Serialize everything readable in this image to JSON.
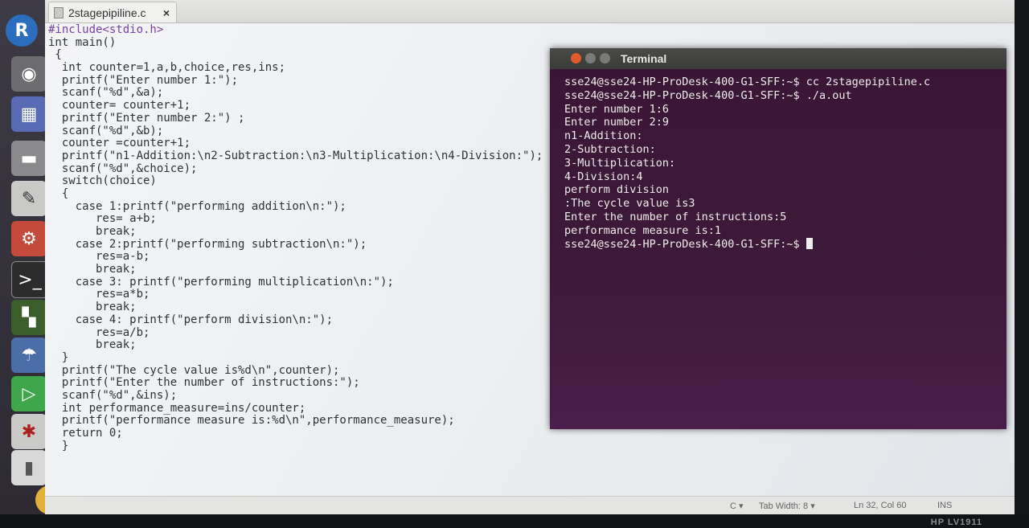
{
  "editor": {
    "tab_title": "2stagepipiline.c",
    "tab_close": "×",
    "code_lines": [
      "#include<stdio.h>",
      "int main()",
      " {",
      "  int counter=1,a,b,choice,res,ins;",
      "  printf(\"Enter number 1:\");",
      "  scanf(\"%d\",&a);",
      "  counter= counter+1;",
      "  printf(\"Enter number 2:\") ;",
      "  scanf(\"%d\",&b);",
      "  counter =counter+1;",
      "  printf(\"n1-Addition:\\n2-Subtraction:\\n3-Multiplication:\\n4-Division:\");",
      "  scanf(\"%d\",&choice);",
      "  switch(choice)",
      "  {",
      "    case 1:printf(\"performing addition\\n:\");",
      "       res= a+b;",
      "       break;",
      "    case 2:printf(\"performing subtraction\\n:\");",
      "       res=a-b;",
      "       break;",
      "    case 3: printf(\"performing multiplication\\n:\");",
      "       res=a*b;",
      "       break;",
      "    case 4: printf(\"perform division\\n:\");",
      "       res=a/b;",
      "       break;",
      "  }",
      "  printf(\"The cycle value is%d\\n\",counter);",
      "  printf(\"Enter the number of instructions:\");",
      "  scanf(\"%d\",&ins);",
      "  int performance_measure=ins/counter;",
      "  printf(\"performance measure is:%d\\n\",performance_measure);",
      "  return 0;",
      "  }"
    ],
    "status": {
      "language": "C ▾",
      "tab_width": "Tab Width: 8 ▾",
      "position": "Ln 32, Col 60",
      "mode": "INS"
    }
  },
  "terminal": {
    "title": "Terminal",
    "lines": [
      "sse24@sse24-HP-ProDesk-400-G1-SFF:~$ cc 2stagepipiline.c",
      "sse24@sse24-HP-ProDesk-400-G1-SFF:~$ ./a.out",
      "Enter number 1:6",
      "Enter number 2:9",
      "n1-Addition:",
      "2-Subtraction:",
      "3-Multiplication:",
      "4-Division:4",
      "perform division",
      ":The cycle value is3",
      "Enter the number of instructions:5",
      "performance measure is:1"
    ],
    "prompt": "sse24@sse24-HP-ProDesk-400-G1-SFF:~$ "
  },
  "launcher": {
    "dash_label": "R",
    "items": [
      "dash-icon",
      "camera-icon",
      "remote-desktop-icon",
      "drive-icon",
      "text-editor-icon",
      "settings-icon",
      "terminal-icon",
      "workspace-icon",
      "network-icon",
      "media-play-icon",
      "bug-icon",
      "usb-icon",
      "chrome-icon"
    ]
  },
  "monitor": {
    "brand": "HP LV1911"
  }
}
